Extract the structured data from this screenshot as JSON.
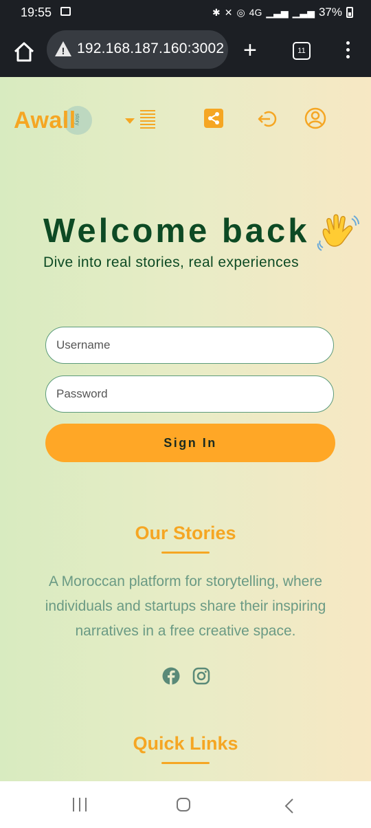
{
  "status_bar": {
    "time": "19:55",
    "network": "4G",
    "battery": "37%",
    "icons": [
      "image-icon",
      "bluetooth-icon",
      "mute-icon",
      "hotspot-icon",
      "signal-icon",
      "signal-icon",
      "battery-icon"
    ]
  },
  "browser": {
    "url": "192.168.187.160:3002",
    "tab_count": "11",
    "icons": [
      "home-icon",
      "warning-icon",
      "plus-icon",
      "tabs-icon",
      "more-vert-icon"
    ]
  },
  "header": {
    "logo_text": "Awall",
    "logo_sub": "story",
    "icons": [
      "menu-dropdown-icon",
      "share-icon",
      "logout-icon",
      "profile-icon"
    ]
  },
  "login": {
    "title": "Welcome back",
    "subtitle": "Dive into real stories, real experiences",
    "username_placeholder": "Username",
    "password_placeholder": "Password",
    "signin_label": "Sign In"
  },
  "footer": {
    "stories_title": "Our Stories",
    "description": "A Moroccan platform for storytelling, where individuals and startups share their inspiring narratives in a free creative space.",
    "social_icons": [
      "facebook-icon",
      "instagram-icon"
    ],
    "quick_links_title": "Quick Links"
  },
  "colors": {
    "accent": "#f5a623",
    "dark_green": "#0d4a24",
    "muted_green": "#6a9a84",
    "button": "#ffa726"
  }
}
